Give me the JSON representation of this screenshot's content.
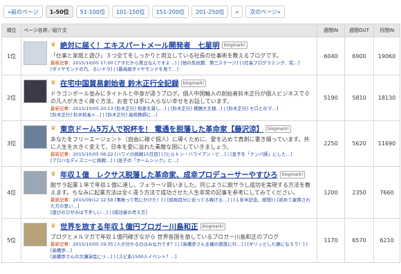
{
  "pager": [
    "«前のページ",
    "1-50位",
    "51-100位",
    "101-150位",
    "151-200位",
    "201-250位",
    "»",
    "次のページ»"
  ],
  "headers": {
    "rank": "順位",
    "page": "ページ名称／紹介文",
    "week_in": "週間IN",
    "week_out": "週間OUT",
    "month_in": "月間IN"
  },
  "badge": "blogmark!",
  "latest_label": "最新記事：",
  "rows": [
    {
      "rank": "1位",
      "title": "絶対に届く！エキスパートメール開発者　七星明",
      "desc": "「仕事と家庭と遊び」３つ全てをしっかりと両立している社長の仕事術を教えるブログです。",
      "latest1": "2015/10/05 17:00 [アホだから質立なんですよ…] | [他の反抗期、第三ステージ] | [社長プログラミング、完…]",
      "latest2": "[ダイヤモンドの乃、るいドラ] | [最高級ダイヤモンドを見て…]",
      "week_in": "6040",
      "week_out": "6900",
      "month_in": "19060",
      "thumb_color": "#cfd8e3"
    },
    {
      "rank": "2位",
      "title": "在宅中国貿易創始者 鈴木正行全記録",
      "desc": "ドラゴンボール並みにタイトルと中身が違うブログ。個人中国輸入の創始者鈴木正行が個人ビジネスで０の凡人が大きく稼ぐ方法、お金では手に入らない幸せをお話しています。",
      "latest1": "2015/10/05 20:13 [鈴木正行] 知恵を貸し…] | [鈴木正行] 標題大王様…] | [鈴木正行] セロとのマ…]",
      "latest2": "[鈴木正行] 鈴木校長×…] | [鈴木正行] 高校教師に…]",
      "week_in": "5190",
      "week_out": "5810",
      "month_in": "18130",
      "thumb_color": "#3a3a48"
    },
    {
      "rank": "3位",
      "title": "東京ドーム5万人で祝杯を！ 電通を脱藩した革命家【藤沢涼】",
      "desc": "あなたをフリーエージェント（自由に稼ぐ個人）に導くために、愛を込めて真剣に書き綴っています。共に人生を大きく変えて、日本を愛に溢れた素敵な国にしていきましょう。",
      "latest1": "2015/10/05 06:22 [ハワイの挑戦15日目] | [ヒルトン・ハワイアン・ビ…] | [息子を「ナンパ師」にした…]",
      "latest2": "[アロハなディズニーに挑戦…] | [息子の「ホームシック」と…]",
      "week_in": "2250",
      "week_out": "5620",
      "month_in": "11690",
      "thumb_color": "#6a7f9a"
    },
    {
      "rank": "4位",
      "title": "年収１億　レクサス脱藩した革命家、成幸プロデューサーやすひろ",
      "desc": "脱サラ起業１年で年収１億に達し、フェラーリ買いました。同じように脱サラし成功を実現する方法を教えます。ちなみに起業方法は全く違う方法で成功させた人生非常の記事を参考にしてみてください。",
      "latest1": "2015/09/12 12:58 [事故って死にかけた！] | [結局目分に合ってる稼げる…] | [１年半記念、感想] | [初めて雇用された方の思い…]",
      "latest2": "[遊びのひがみは下手しい…] | [成功者の考え方]",
      "week_in": "1200",
      "week_out": "2350",
      "month_in": "7660",
      "thumb_color": "#9aa7b4"
    },
    {
      "rank": "5位",
      "title": "世界を旅する年収１億円ブロガー川島和正",
      "desc": "ブログとメルマガで年収１億円稼ぎながら 世界各国を旅しているブロガー川島和正のブログ",
      "latest1": "2015/10/05 19:35 [人が分かるのはみな力です？] | [高橋歩さん主催の旅旅に行…] | [ギリッとした勝になろう！] | [高橋歩…]",
      "latest2": "[高橋歩さんの大講演会にリ…] | [スピ系1500人イベント？…]",
      "week_in": "1170",
      "week_out": "6570",
      "month_in": "6210",
      "thumb_color": "#b9a27a"
    }
  ]
}
